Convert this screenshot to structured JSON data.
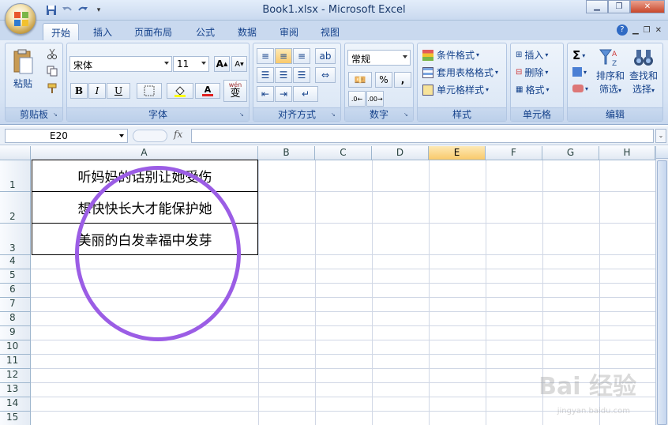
{
  "window": {
    "title": "Book1.xlsx - Microsoft Excel"
  },
  "tabs": [
    "开始",
    "插入",
    "页面布局",
    "公式",
    "数据",
    "审阅",
    "视图"
  ],
  "ribbon": {
    "clipboard": {
      "paste": "粘贴",
      "label": "剪贴板"
    },
    "font": {
      "name": "宋体",
      "size": "11",
      "bold": "B",
      "italic": "I",
      "underline": "U",
      "label": "字体",
      "wen": "wén",
      "wen_char": "变"
    },
    "alignment": {
      "label": "对齐方式"
    },
    "number": {
      "format": "常规",
      "percent": "%",
      "comma": ",",
      "label": "数字"
    },
    "styles": {
      "conditional": "条件格式",
      "table": "套用表格格式",
      "cell": "单元格样式",
      "label": "样式"
    },
    "cells": {
      "insert": "插入",
      "delete": "删除",
      "format": "格式",
      "label": "单元格"
    },
    "editing": {
      "sort1": "排序和",
      "sort2": "筛选",
      "find1": "查找和",
      "find2": "选择",
      "label": "编辑"
    }
  },
  "formula_bar": {
    "name_box": "E20",
    "fx": "fx",
    "value": ""
  },
  "columns": [
    "A",
    "B",
    "C",
    "D",
    "E",
    "F",
    "G",
    "H"
  ],
  "selected_column": "E",
  "rows": [
    "1",
    "2",
    "3",
    "4",
    "5",
    "6",
    "7",
    "8",
    "9",
    "10",
    "11",
    "12",
    "13",
    "14",
    "15"
  ],
  "cells": {
    "A1": "听妈妈的话别让她受伤",
    "A2": "想快快长大才能保护她",
    "A3": "美丽的白发幸福中发芽"
  },
  "watermark": {
    "text": "Bai 经验",
    "url": "jingyan.baidu.com"
  },
  "colors": {
    "circle": "#9b5de5",
    "selected_header": "#f9c96b"
  }
}
